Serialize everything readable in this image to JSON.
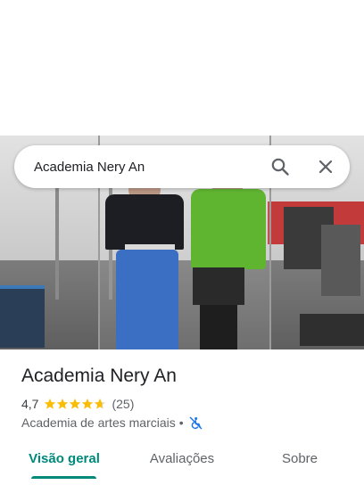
{
  "search": {
    "value": "Academia Nery An"
  },
  "place": {
    "title": "Academia Nery An",
    "rating": "4,7",
    "stars_filled": 4.7,
    "review_count": "(25)",
    "category": "Academia de artes marciais",
    "separator": "•"
  },
  "tabs": [
    {
      "label": "Visão geral",
      "active": true
    },
    {
      "label": "Avaliações",
      "active": false
    },
    {
      "label": "Sobre",
      "active": false
    }
  ],
  "colors": {
    "accent": "#00897b",
    "star": "#fbbc04",
    "accessibility_icon": "#1a73e8",
    "icon_gray": "#5f6368"
  },
  "icons": {
    "search": "search-icon",
    "close": "close-icon",
    "accessibility": "wheelchair-not-accessible-icon"
  }
}
